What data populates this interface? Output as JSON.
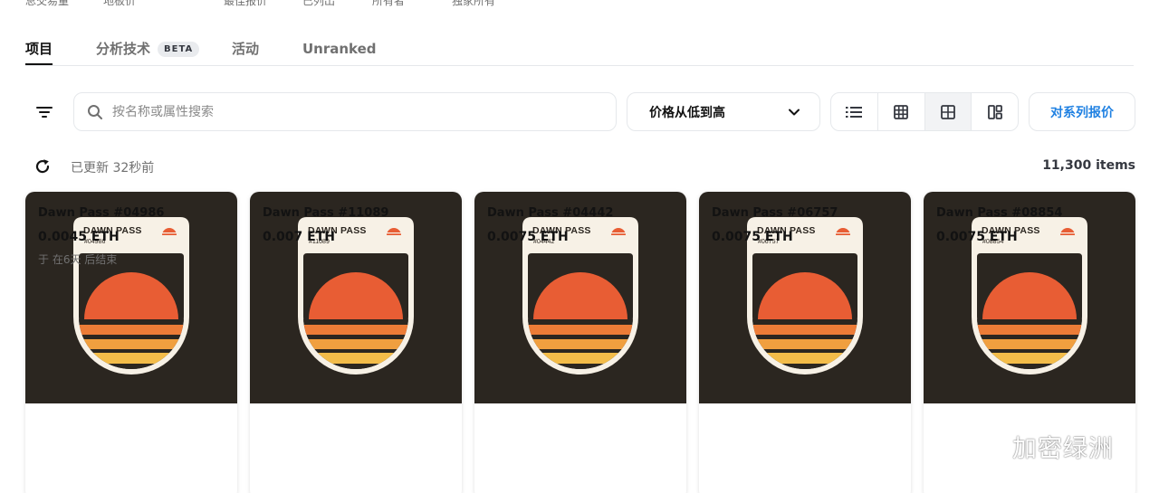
{
  "stats": [
    "总交易量",
    "地板价",
    "最佳报价",
    "已列出",
    "所有者",
    "独家所有"
  ],
  "tabs": [
    {
      "label": "项目",
      "active": true
    },
    {
      "label": "分析技术",
      "badge": "BETA"
    },
    {
      "label": "活动"
    },
    {
      "label": "Unranked"
    }
  ],
  "toolbar": {
    "search_placeholder": "按名称或属性搜索",
    "sort_label": "价格从低到高",
    "offer_label": "对系列报价"
  },
  "status": {
    "updated": "已更新 32秒前",
    "count": "11,300 items"
  },
  "colors": {
    "accent": "#2081e2",
    "card_bg": "#2b2620",
    "sun": "#e85d34",
    "stripe1": "#ec7c37",
    "stripe2": "#f09f3f",
    "stripe3": "#f3bc49"
  },
  "cards": [
    {
      "pass_title": "DAWN PASS",
      "pass_num": "#04986",
      "name": "Dawn Pass #04986",
      "price": "0.0045 ETH",
      "meta": "于 在6天 后结束"
    },
    {
      "pass_title": "DAWN PASS",
      "pass_num": "#11089",
      "name": "Dawn Pass #11089",
      "price": "0.007 ETH",
      "meta": ""
    },
    {
      "pass_title": "DAWN PASS",
      "pass_num": "#04442",
      "name": "Dawn Pass #04442",
      "price": "0.0075 ETH",
      "meta": ""
    },
    {
      "pass_title": "DAWN PASS",
      "pass_num": "#06757",
      "name": "Dawn Pass #06757",
      "price": "0.0075 ETH",
      "meta": ""
    },
    {
      "pass_title": "DAWN PASS",
      "pass_num": "#08854",
      "name": "Dawn Pass #08854",
      "price": "0.0075 ETH",
      "meta": ""
    }
  ],
  "watermark": {
    "text": "加密绿洲",
    "icon": "wechat-icon"
  }
}
